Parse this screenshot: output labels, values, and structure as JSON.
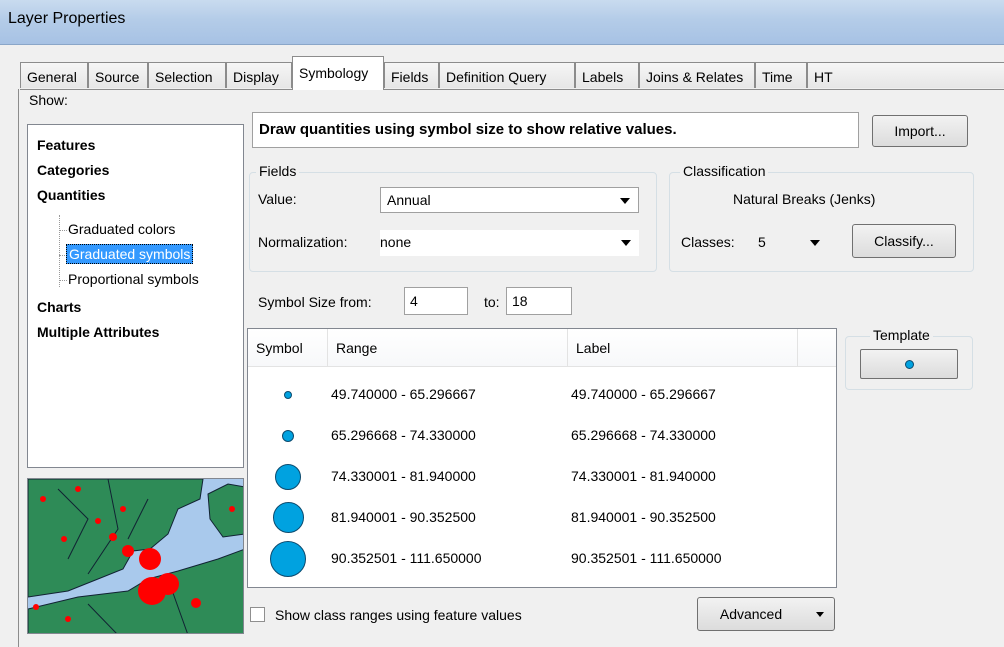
{
  "window": {
    "title": "Layer Properties"
  },
  "tabs": [
    "General",
    "Source",
    "Selection",
    "Display",
    "Symbology",
    "Fields",
    "Definition Query",
    "Labels",
    "Joins & Relates",
    "Time",
    "HT"
  ],
  "show": {
    "label": "Show:",
    "items": [
      "Features",
      "Categories",
      "Quantities"
    ],
    "subitems": [
      "Graduated colors",
      "Graduated symbols",
      "Proportional symbols"
    ],
    "items_after": [
      "Charts",
      "Multiple Attributes"
    ]
  },
  "description": "Draw quantities using symbol size to show relative values.",
  "import_label": "Import...",
  "fields": {
    "group_label": "Fields",
    "value_label": "Value:",
    "value": "Annual",
    "normalization_label": "Normalization:",
    "normalization": "none"
  },
  "classification": {
    "group_label": "Classification",
    "method": "Natural Breaks (Jenks)",
    "classes_label": "Classes:",
    "classes": "5",
    "classify_label": "Classify..."
  },
  "symbol_size": {
    "from_label": "Symbol Size from:",
    "from": "4",
    "to_label": "to:",
    "to": "18"
  },
  "table": {
    "headers": [
      "Symbol",
      "Range",
      "Label"
    ],
    "rows": [
      {
        "range": "49.740000 - 65.296667",
        "label": "49.740000 - 65.296667"
      },
      {
        "range": "65.296668 - 74.330000",
        "label": "65.296668 - 74.330000"
      },
      {
        "range": "74.330001 - 81.940000",
        "label": "74.330001 - 81.940000"
      },
      {
        "range": "81.940001 - 90.352500",
        "label": "81.940001 - 90.352500"
      },
      {
        "range": "90.352501 - 111.650000",
        "label": "90.352501 - 111.650000"
      }
    ]
  },
  "template_label": "Template",
  "show_class_ranges_label": "Show class ranges using feature values",
  "advanced_label": "Advanced",
  "colors": {
    "symbol_fill": "#00a2e0",
    "preview_land": "#2e8b57",
    "preview_water": "#a9c9ec",
    "preview_dot": "#ff0000"
  }
}
